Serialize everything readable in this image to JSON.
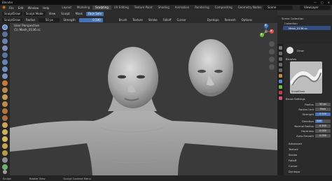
{
  "window": {
    "title": "Blender",
    "controls": [
      "—",
      "▢",
      "✕"
    ]
  },
  "menu": [
    "File",
    "Edit",
    "Window",
    "Help"
  ],
  "workspaces": {
    "tabs": [
      "Layout",
      "Modeling",
      "Sculpting",
      "UV Editing",
      "Texture Paint",
      "Shading",
      "Animation",
      "Rendering",
      "Compositing",
      "Geometry Nodes",
      "Scripting"
    ],
    "active": "Sculpting"
  },
  "scene": {
    "name": "Scene"
  },
  "view_layer": {
    "name": "ViewLayer"
  },
  "tool_header": {
    "brush_name": "SculptDraw",
    "mode": "Sculpt Mode",
    "view": "View",
    "sculpt": "Sculpt",
    "mask": "Mask",
    "face_sets": "Face Sets",
    "radius_label": "Radius",
    "radius_value": "50 px",
    "strength_label": "Strength",
    "strength_value": "0.500",
    "menus": [
      "Brush",
      "Texture",
      "Stroke",
      "Falloff",
      "Cursor"
    ],
    "dyntopo": "Dyntopo",
    "remesh": "Remesh",
    "options": "Options"
  },
  "viewport": {
    "view_name": "User Perspective",
    "object_name": "(1) Mesh_0136.sc",
    "gizmo_axes": [
      "X",
      "Y",
      "Z"
    ]
  },
  "outliner": {
    "scene_collection": "Scene Collection",
    "collection": "Collection",
    "object": "Mesh_0136.sc"
  },
  "properties": {
    "brush_name": "Draw",
    "sections": {
      "brushes": "Brushes",
      "brush_settings": "Brush Settings",
      "advanced": "Advanced",
      "texture": "Texture",
      "stroke": "Stroke",
      "falloff": "Falloff",
      "cursor": "Cursor",
      "dyntopo": "Dyntopo"
    },
    "brush_thumb_label": "SculptDraw",
    "settings": [
      {
        "label": "Radius",
        "value": "50 px"
      },
      {
        "label": "Radius Unit",
        "value": "View"
      },
      {
        "label": "Strength",
        "value": "0.500"
      },
      {
        "label": "Direction",
        "value": "Add"
      },
      {
        "label": "Normal Radius",
        "value": "0.500"
      },
      {
        "label": "Hardness",
        "value": "0.000"
      },
      {
        "label": "Auto-Smooth",
        "value": "0.000"
      }
    ]
  },
  "status_bar": [
    "Sculpt",
    "Rotate View",
    "Sculpt Context Menu"
  ],
  "colors": {
    "accent_blue": "#4772b3",
    "brand_orange": "#e87d0d"
  }
}
